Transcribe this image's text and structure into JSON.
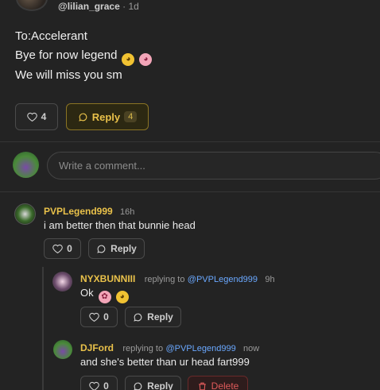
{
  "post": {
    "author_handle": "@lilian_grace",
    "time_ago": "1d",
    "lines": [
      "To:Accelerant",
      "Bye for now legend",
      "We will miss you sm"
    ],
    "likes": "4",
    "reply_label": "Reply",
    "reply_count": "4"
  },
  "comment_box": {
    "placeholder": "Write a comment..."
  },
  "comments": [
    {
      "name": "PVPLegend999",
      "time": "16h",
      "text": "i am better then that bunnie head",
      "likes": "0",
      "reply_label": "Reply"
    },
    {
      "name": "NYXBUNNIII",
      "replying_to_label": "replying to",
      "replying_to": "@PVPLegend999",
      "time": "9h",
      "text": "Ok",
      "likes": "0",
      "reply_label": "Reply"
    },
    {
      "name": "DJFord",
      "replying_to_label": "replying to",
      "replying_to": "@PVPLegend999",
      "time": "now",
      "text": "and she's better than ur head fart999",
      "likes": "0",
      "reply_label": "Reply",
      "delete_label": "Delete"
    }
  ],
  "colors": {
    "background": "#232323",
    "accent_gold": "#e9c14a",
    "link_blue": "#6aa8ff",
    "danger_red": "#e05a5a"
  }
}
